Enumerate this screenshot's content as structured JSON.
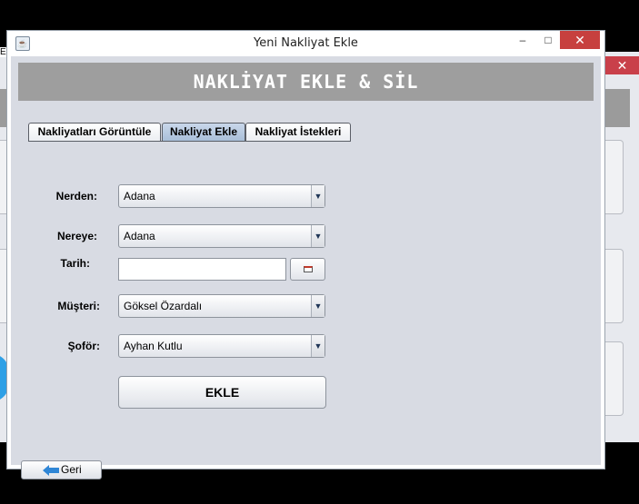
{
  "window": {
    "title": "Yeni Nakliyat Ekle",
    "minimize": "–",
    "maximize": "□",
    "close": "✕",
    "icon": "java-app-icon"
  },
  "background_window": {
    "close": "✕",
    "edge_text": "E"
  },
  "header": {
    "title": "NAKLİYAT EKLE & SİL"
  },
  "tabs": [
    {
      "label": "Nakliyatları Görüntüle",
      "active": false
    },
    {
      "label": "Nakliyat Ekle",
      "active": true
    },
    {
      "label": "Nakliyat İstekleri",
      "active": false
    }
  ],
  "form": {
    "nerden": {
      "label": "Nerden:",
      "value": "Adana"
    },
    "nereye": {
      "label": "Nereye:",
      "value": "Adana"
    },
    "tarih": {
      "label": "Tarih:",
      "value": ""
    },
    "musteri": {
      "label": "Müşteri:",
      "value": "Göksel Özardalı"
    },
    "sofor": {
      "label": "Şoför:",
      "value": "Ayhan Kutlu"
    },
    "combo_arrow": "▼",
    "submit_label": "EKLE"
  },
  "footer": {
    "back_label": "Geri"
  },
  "colors": {
    "header_bg": "#9e9e9e",
    "content_bg": "#d8dbe3",
    "active_tab": "#b4c8e0",
    "close_red": "#c7403e"
  }
}
